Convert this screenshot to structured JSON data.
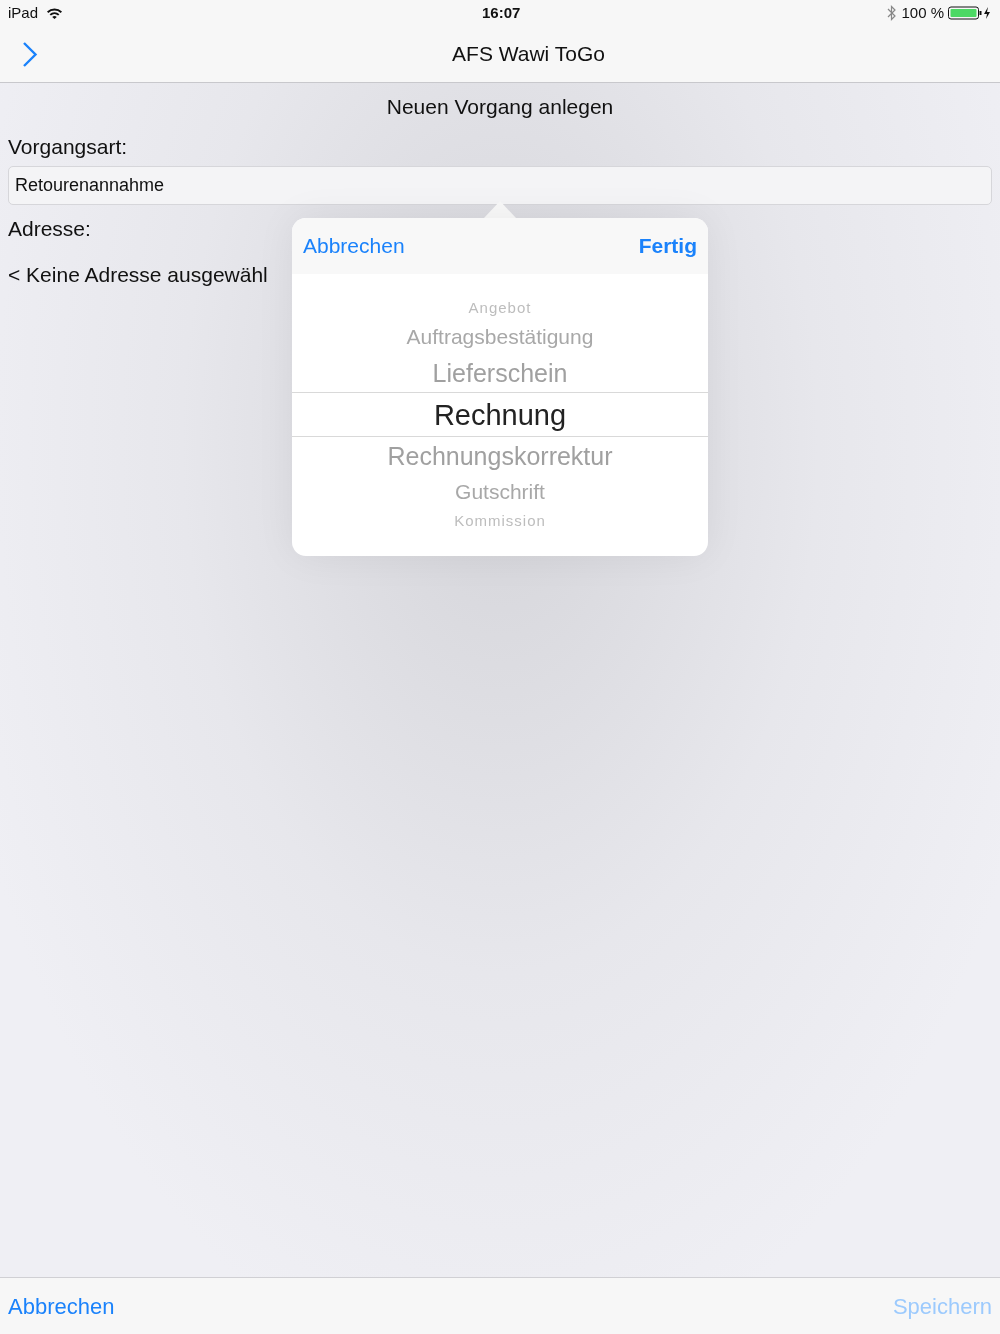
{
  "status_bar": {
    "device": "iPad",
    "time": "16:07",
    "battery": "100 %"
  },
  "nav_bar": {
    "title": "AFS Wawi ToGo"
  },
  "form": {
    "heading": "Neuen Vorgang anlegen",
    "type_label": "Vorgangsart:",
    "type_value": "Retourenannahme",
    "address_label": "Adresse:",
    "address_value": "< Keine Adresse ausgewähl"
  },
  "picker": {
    "cancel": "Abbrechen",
    "done": "Fertig",
    "items": [
      {
        "label": "Angebot",
        "selected": false
      },
      {
        "label": "Auftragsbestätigung",
        "selected": false
      },
      {
        "label": "Lieferschein",
        "selected": false
      },
      {
        "label": "Rechnung",
        "selected": true
      },
      {
        "label": "Rechnungskorrektur",
        "selected": false
      },
      {
        "label": "Gutschrift",
        "selected": false
      },
      {
        "label": "Kommission",
        "selected": false
      }
    ]
  },
  "toolbar": {
    "cancel": {
      "label": "Abbrechen",
      "disabled": false
    },
    "save": {
      "label": "Speichern",
      "disabled": true
    }
  }
}
